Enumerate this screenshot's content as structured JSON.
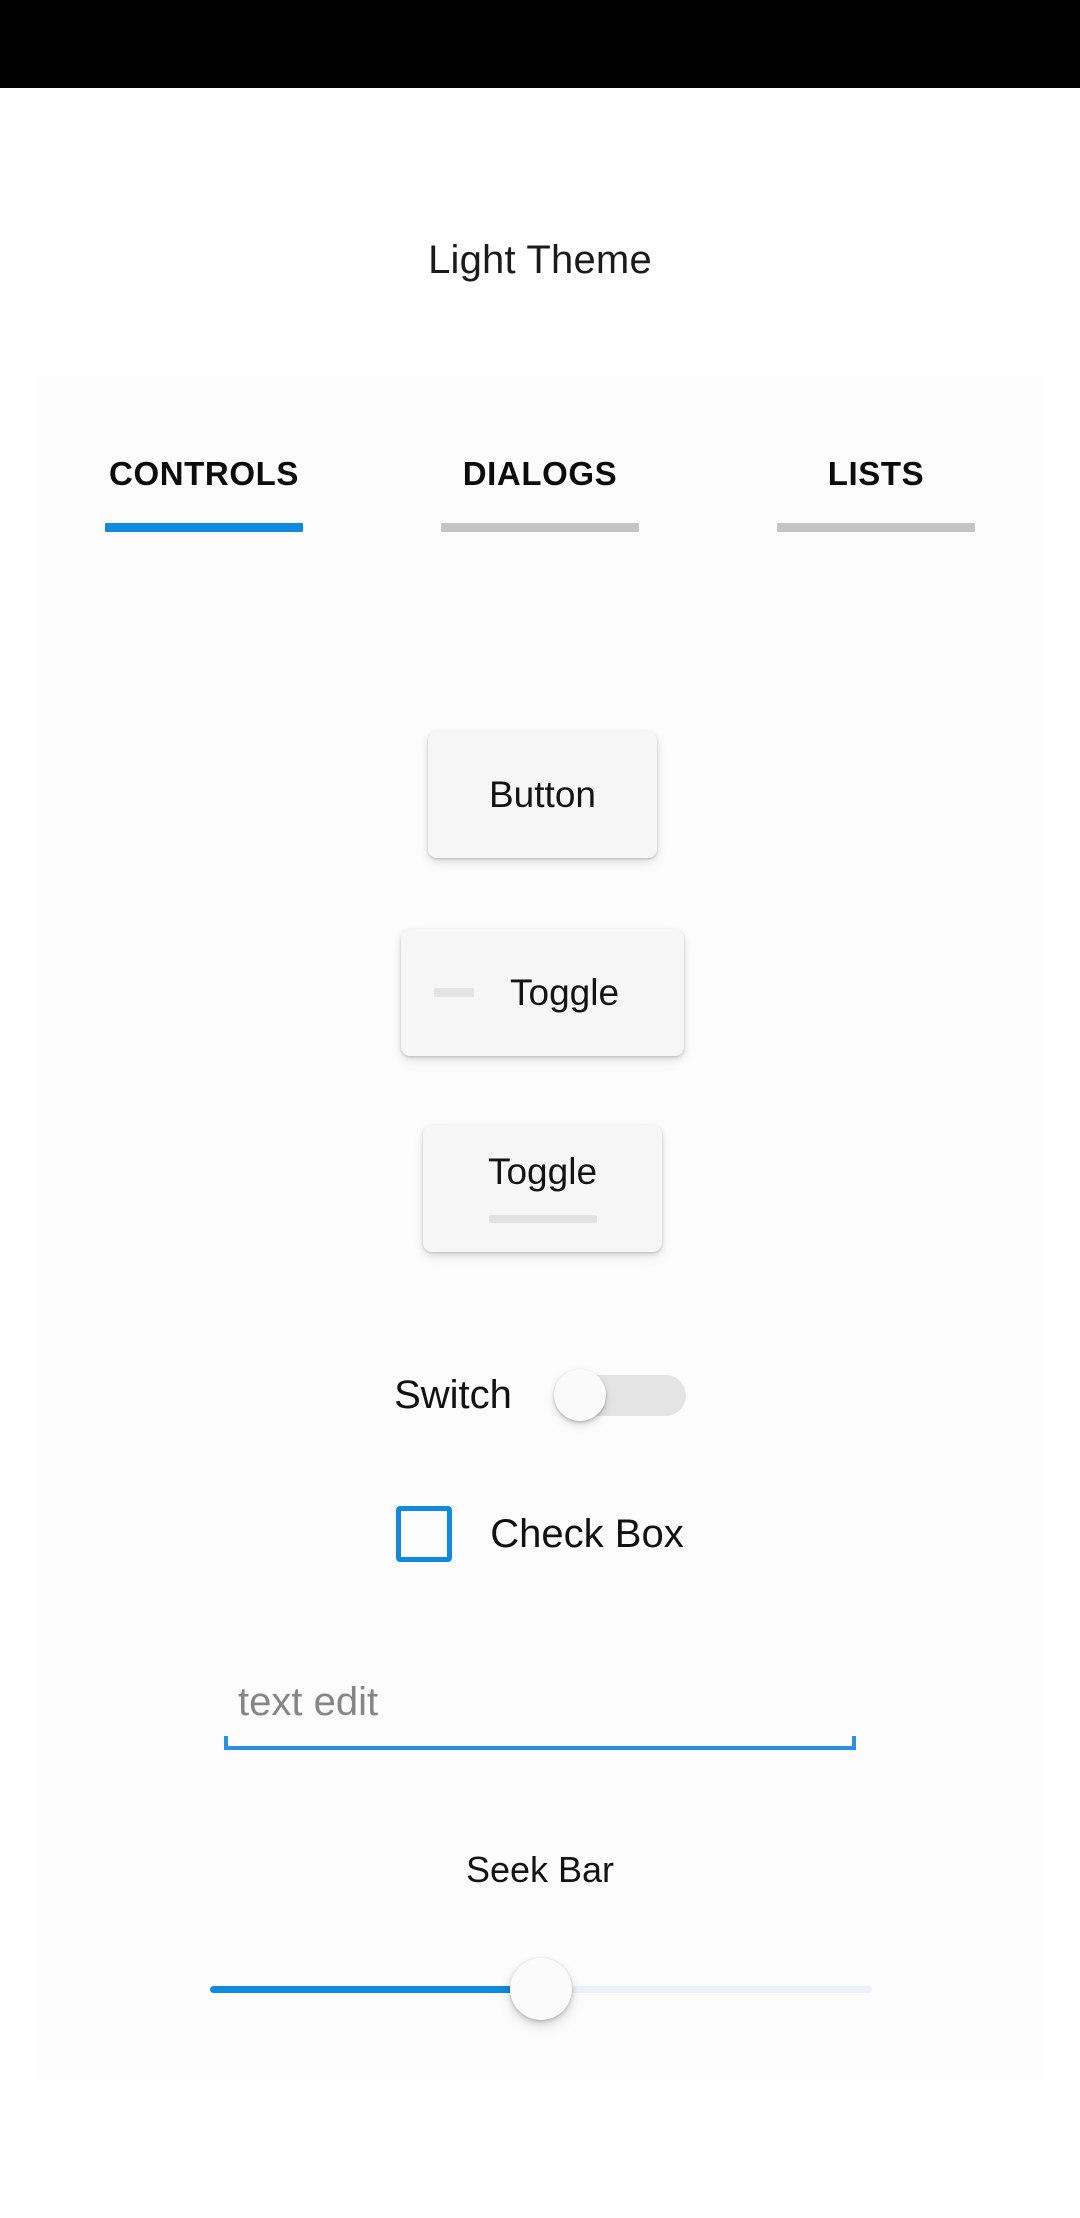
{
  "status_bar": {
    "background": "#000000"
  },
  "header": {
    "title": "Light Theme"
  },
  "tabs": {
    "active_index": 0,
    "active_color": "#1089e0",
    "inactive_color": "#c4c4c4",
    "items": [
      {
        "label": "CONTROLS"
      },
      {
        "label": "DIALOGS"
      },
      {
        "label": "LISTS"
      }
    ]
  },
  "controls": {
    "button": {
      "label": "Button"
    },
    "toggle_one": {
      "label": "Toggle",
      "checked": false,
      "indicator": "dash"
    },
    "toggle_two": {
      "label": "Toggle",
      "checked": false,
      "indicator": "underline"
    },
    "switch": {
      "label": "Switch",
      "checked": false,
      "track_color": "#e4e4e5",
      "thumb_color": "#fafafa"
    },
    "checkbox": {
      "label": "Check Box",
      "checked": false,
      "accent_color": "#1089e0"
    },
    "text_edit": {
      "value": "",
      "placeholder": "text edit",
      "underline_color": "#2b8fe0"
    },
    "seek_bar": {
      "label": "Seek Bar",
      "value": 50,
      "min": 0,
      "max": 100,
      "fill_color": "#1089e0",
      "track_color": "#eaf1fa"
    }
  }
}
